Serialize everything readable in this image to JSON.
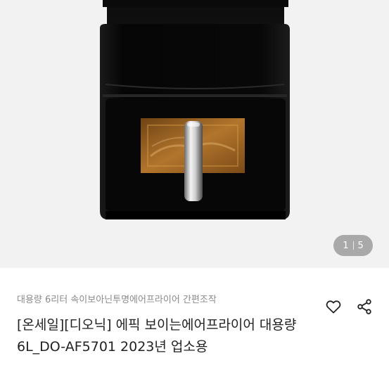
{
  "gallery": {
    "current_page": "1",
    "total_pages": "5",
    "image_subject": "black air fryer with transparent window"
  },
  "product": {
    "subtitle": "대용량 6리터 속이보아닌투명에어프라이어 간편조작",
    "title": "[온세일][디오닉] 에픽 보이는에어프라이어 대용량 6L_DO-AF5701 2023년 업소용"
  },
  "icons": {
    "like": "heart-icon",
    "share": "share-icon"
  },
  "colors": {
    "body_black": "#0d0d0d",
    "window_amber": "#a86a22",
    "background": "#f2f2f2",
    "subtitle_gray": "#8a8a8a",
    "title_text": "#222222"
  }
}
